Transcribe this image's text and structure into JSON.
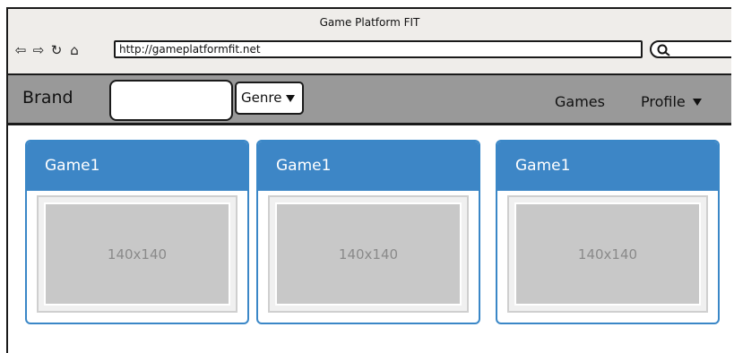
{
  "window": {
    "title": "Game Platform FIT"
  },
  "toolbar": {
    "icons": [
      "back-icon",
      "forward-icon",
      "refresh-icon",
      "home-icon"
    ],
    "url": "http://gameplatformfit.net"
  },
  "navbar": {
    "brand": "Brand",
    "genre_label": "Genre",
    "games_label": "Games",
    "profile_label": "Profile"
  },
  "games": [
    {
      "title": "Game1",
      "image_label": "140x140"
    },
    {
      "title": "Game1",
      "image_label": "140x140"
    },
    {
      "title": "Game1",
      "image_label": "140x140"
    }
  ],
  "colors": {
    "navbar_bg": "#999999",
    "card_accent": "#3d86c6",
    "image_placeholder": "#c8c8c8",
    "chrome_bg": "#efedea"
  }
}
